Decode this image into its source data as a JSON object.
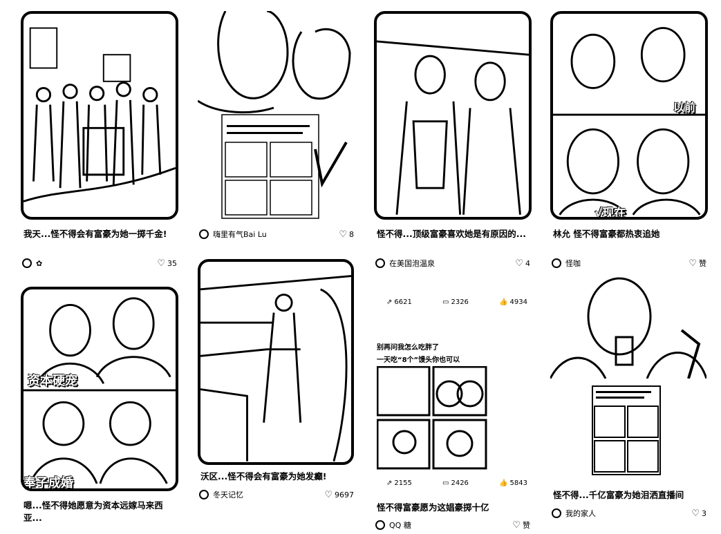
{
  "cards": [
    {
      "title": "我天...怪不得会有富豪为她一掷千金!",
      "author": "✿",
      "likes": "35"
    },
    {
      "title": "",
      "author": "嗨里有气Bai Lu",
      "likes": "8"
    },
    {
      "title": "怪不得...顶级富豪喜欢她是有原因的...",
      "author": "在美国泡温泉",
      "likes": "4"
    },
    {
      "title": "林允 怪不得富豪都热衷追她",
      "author": "怪咖",
      "likes": "赞"
    },
    {
      "title": "嗯...怪不得她愿意为资本远嫁马来西亚...",
      "author": "",
      "likes": "",
      "overlay_top": "资本硬宠",
      "overlay_bottom": "奉子成婚"
    },
    {
      "title": "沃区...怪不得会有富豪为她发癫!",
      "author": "冬天记忆",
      "likes": "9697"
    },
    {
      "title": "怪不得富豪愿为这娼豪掷十亿",
      "author": "QQ 糖",
      "likes": "赞",
      "stats_top": {
        "shares": "6621",
        "comments": "2326",
        "likes": "4934"
      },
      "caption1": "别再问我怎么吃胖了",
      "caption2": "一天吃“8个”馒头你也可以",
      "stats_bottom": {
        "shares": "2155",
        "comments": "2426",
        "likes": "5843"
      }
    },
    {
      "title": "怪不得...千亿富豪为她泪洒直播间",
      "author": "我的家人",
      "likes": "3"
    }
  ],
  "card2_overlays": {
    "overlay_a": "以前",
    "overlay_b": "√现在"
  }
}
